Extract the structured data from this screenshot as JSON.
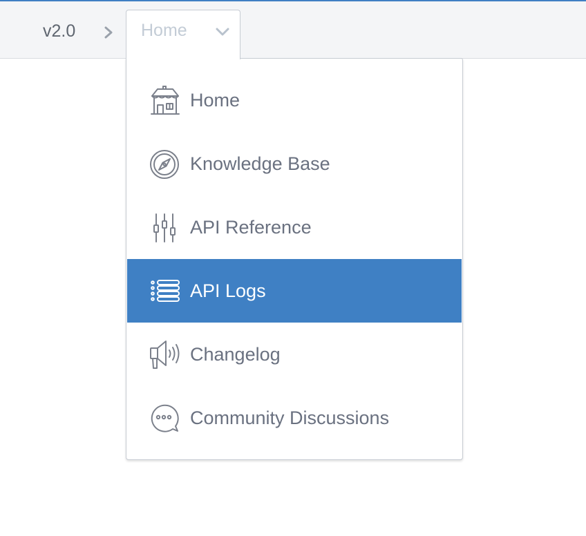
{
  "breadcrumb": {
    "version": "v2.0",
    "separator_icon": "chevron-right-icon"
  },
  "nav_select": {
    "current": "Home",
    "caret_icon": "chevron-down-icon"
  },
  "menu": {
    "active_color": "#3f80c4",
    "items": [
      {
        "label": "Home",
        "icon": "house-icon",
        "active": false
      },
      {
        "label": "Knowledge Base",
        "icon": "compass-icon",
        "active": false
      },
      {
        "label": "API Reference",
        "icon": "sliders-icon",
        "active": false
      },
      {
        "label": "API Logs",
        "icon": "list-icon",
        "active": true
      },
      {
        "label": "Changelog",
        "icon": "megaphone-icon",
        "active": false
      },
      {
        "label": "Community Discussions",
        "icon": "chat-bubble-icon",
        "active": false
      }
    ]
  }
}
